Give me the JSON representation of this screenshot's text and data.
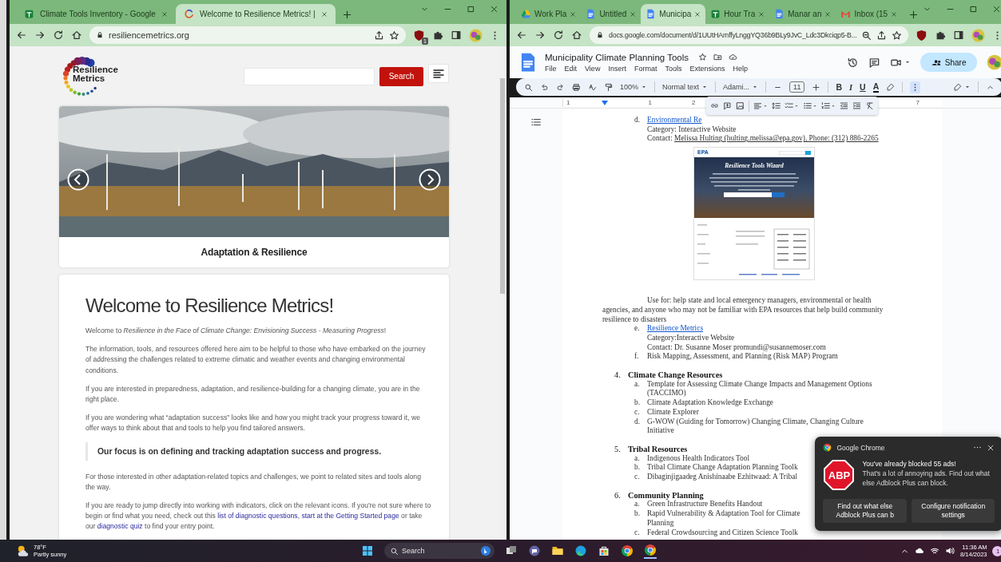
{
  "left_window": {
    "tabs": [
      {
        "kind": "sheets",
        "title": "Climate Tools Inventory - Google",
        "selected": false
      },
      {
        "kind": "site",
        "title": "Welcome to Resilience Metrics! |",
        "selected": true
      }
    ],
    "address": "resiliencemetrics.org",
    "extension_badge": "1",
    "page": {
      "logo_text": "Resilience Metrics",
      "search_button": "Search",
      "carousel_caption": "Adaptation & Resilience",
      "heading": "Welcome to Resilience Metrics!",
      "paragraphs": [
        {
          "kind": "text",
          "parts": [
            {
              "text": "Welcome to *Resilience in the Face of Climate Change: Envisioning Success - Measuring Progress*!",
              "link": false
            }
          ]
        },
        {
          "kind": "text",
          "parts": [
            {
              "text": "The information, tools, and resources offered here aim to be helpful to those who have embarked on the journey of addressing the challenges related to extreme climatic and weather events and changing environmental conditions.",
              "link": false
            }
          ]
        },
        {
          "kind": "text",
          "parts": [
            {
              "text": "If you are interested in preparedness, adaptation, and resilience-building for a changing climate, you are in the right place.",
              "link": false
            }
          ]
        },
        {
          "kind": "text",
          "parts": [
            {
              "text": "If you are wondering what “adaptation success” looks like and how you might track your progress toward it, we offer ways to think about that and tools to help you find tailored answers.",
              "link": false
            }
          ]
        },
        {
          "kind": "quote",
          "parts": [
            {
              "text": "Our focus is on defining and tracking adaptation success and progress.",
              "link": false
            }
          ]
        },
        {
          "kind": "text",
          "parts": [
            {
              "text": "For those interested in other adaptation-related topics and challenges, we point to related sites and tools along the way.",
              "link": false
            }
          ]
        },
        {
          "kind": "text",
          "parts": [
            {
              "text": "If you are ready to jump directly into working with indicators, click on the relevant icons. If you’re not sure where to begin or find what you need, check out this ",
              "link": false
            },
            {
              "text": "list of diagnostic questions",
              "link": true
            },
            {
              "text": ", ",
              "link": false
            },
            {
              "text": "start at the Getting Started page",
              "link": true
            },
            {
              "text": " or take our ",
              "link": false
            },
            {
              "text": "diagnostic quiz",
              "link": true
            },
            {
              "text": " to find your entry point.",
              "link": false
            }
          ]
        }
      ]
    }
  },
  "right_window": {
    "tabs": [
      {
        "kind": "drive",
        "title": "Work Pla",
        "selected": false
      },
      {
        "kind": "docs",
        "title": "Untitled",
        "selected": false
      },
      {
        "kind": "docs",
        "title": "Municipa",
        "selected": true
      },
      {
        "kind": "sheets",
        "title": "Hour Tra",
        "selected": false
      },
      {
        "kind": "docs",
        "title": "Manar an",
        "selected": false
      },
      {
        "kind": "gmail",
        "title": "Inbox (15",
        "selected": false
      }
    ],
    "address": "docs.google.com/document/d/1UUtHAmffyLnggYQ36b9BLy9JvC_Ldc3Dkciqp5-B...",
    "doc_title": "Municipality Climate Planning Tools",
    "menus": [
      "File",
      "Edit",
      "View",
      "Insert",
      "Format",
      "Tools",
      "Extensions",
      "Help"
    ],
    "share_button": "Share",
    "toolbar": {
      "zoom": "100%",
      "style": "Normal text",
      "font": "Adami...",
      "font_size": "11",
      "format_buttons": [
        "B",
        "I",
        "U",
        "A"
      ]
    },
    "ruler": [
      "1",
      "1",
      "2",
      "7"
    ],
    "document": [
      {
        "kind": "subitem",
        "marker": "d.",
        "text": "Environmental Re",
        "link": true
      },
      {
        "kind": "detail",
        "parts": [
          {
            "text": "Category: Interactive Website",
            "underlined": false
          }
        ]
      },
      {
        "kind": "detail",
        "parts": [
          {
            "text": "Contact: ",
            "underlined": false
          },
          {
            "text": "Melissa Hulting (hulting.melissa@epa.gov), Phone: (312) 886-2265",
            "underlined": true
          }
        ]
      },
      {
        "kind": "screenshot",
        "logo": "EPA",
        "title": "Resilience Tools Wizard"
      },
      {
        "kind": "paragraph",
        "text": "Use for:  help state and local emergency managers, environmental or health agencies, and anyone who may not be familiar with EPA resources that help build community resilience to disasters"
      },
      {
        "kind": "subitem",
        "marker": "e.",
        "text": "Resilience Metrics",
        "link": true
      },
      {
        "kind": "detail",
        "parts": [
          {
            "text": "Category:Interactive Website",
            "underlined": false
          }
        ]
      },
      {
        "kind": "detail",
        "parts": [
          {
            "text": "Contact: Dr. Susanne Moser promundi@susannemoser.com",
            "underlined": false
          }
        ]
      },
      {
        "kind": "subitem",
        "marker": "f.",
        "text": "Risk Mapping, Assessment, and Planning (Risk MAP) Program",
        "link": false
      },
      {
        "kind": "heading",
        "marker": "4.",
        "text": "Climate Change Resources"
      },
      {
        "kind": "subitem",
        "marker": "a.",
        "text": "Template for Assessing Climate Change Impacts and Management Options (TACCIMO)",
        "link": false
      },
      {
        "kind": "subitem",
        "marker": "b.",
        "text": "Climate Adaptation Knowledge Exchange",
        "link": false
      },
      {
        "kind": "subitem",
        "marker": "c.",
        "text": "Climate Explorer",
        "link": false
      },
      {
        "kind": "subitem",
        "marker": "d.",
        "text": "G-WOW (Guiding for Tomorrow) Changing Climate, Changing Culture Initiative",
        "link": false
      },
      {
        "kind": "heading",
        "marker": "5.",
        "text": "Tribal Resources"
      },
      {
        "kind": "subitem",
        "marker": "a.",
        "text": "Indigenous Health Indicators Tool",
        "link": false
      },
      {
        "kind": "subitem",
        "marker": "b.",
        "text": "Tribal Climate Change Adaptation Planning Toolk",
        "link": false
      },
      {
        "kind": "subitem",
        "marker": "c.",
        "text": "Dibaginjigaadeg Anishinaabe Ezhitwaad: A Tribal",
        "link": false
      },
      {
        "kind": "heading",
        "marker": "6.",
        "text": "Community Planning"
      },
      {
        "kind": "subitem",
        "marker": "a.",
        "text": "Green Infrastructure Benefits Handout",
        "link": false
      },
      {
        "kind": "subitem",
        "marker": "b.",
        "text": "Rapid Vulnerability & Adaptation Tool for Climate",
        "link": false
      },
      {
        "kind": "continuation",
        "text": "Planning"
      },
      {
        "kind": "subitem",
        "marker": "c.",
        "text": "Federal Crowdsourcing and Citizen Science Toolk",
        "link": false
      }
    ],
    "notification": {
      "app": "Google Chrome",
      "badge": "ABP",
      "title": "You've already blocked 55 ads!",
      "body": "That's a lot of annoying ads. Find out what else Adblock Plus can block.",
      "buttons": [
        "Find out what else Adblock Plus can b",
        "Configure notification settings"
      ]
    }
  },
  "taskbar": {
    "weather": {
      "temp": "78°F",
      "condition": "Partly sunny"
    },
    "search_placeholder": "Search",
    "clock": {
      "time": "11:36 AM",
      "date": "8/14/2023"
    },
    "notification_count": "1"
  }
}
